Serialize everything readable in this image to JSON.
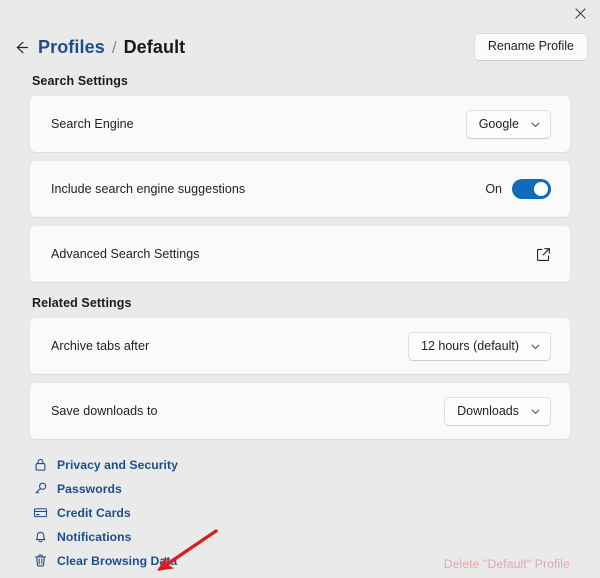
{
  "window": {
    "close_label": "Close",
    "close_icon": "close-icon"
  },
  "header": {
    "back_icon": "arrow-left-icon",
    "breadcrumb_parent": "Profiles",
    "breadcrumb_separator": "/",
    "breadcrumb_current": "Default",
    "rename_button": "Rename Profile"
  },
  "sections": {
    "search": {
      "title": "Search Settings",
      "rows": {
        "search_engine": {
          "label": "Search Engine",
          "value": "Google",
          "chevron_icon": "chevron-down-icon"
        },
        "suggestions": {
          "label": "Include search engine suggestions",
          "state": "On",
          "toggle_icon": "toggle-switch-on"
        },
        "advanced": {
          "label": "Advanced Search Settings",
          "icon": "external-link-icon"
        }
      }
    },
    "related": {
      "title": "Related Settings",
      "rows": {
        "archive_tabs": {
          "label": "Archive tabs after",
          "value": "12 hours (default)",
          "chevron_icon": "chevron-down-icon"
        },
        "save_downloads": {
          "label": "Save downloads to",
          "value": "Downloads",
          "chevron_icon": "chevron-down-icon"
        }
      }
    }
  },
  "links": [
    {
      "label": "Privacy and Security",
      "icon": "lock-icon"
    },
    {
      "label": "Passwords",
      "icon": "key-icon"
    },
    {
      "label": "Credit Cards",
      "icon": "credit-card-icon"
    },
    {
      "label": "Notifications",
      "icon": "bell-icon"
    },
    {
      "label": "Clear Browsing Data",
      "icon": "trash-icon"
    }
  ],
  "delete_profile": {
    "label": "Delete \"Default\" Profile"
  },
  "annotation": {
    "arrow_icon": "red-arrow-pointing-to-clear-browsing-data",
    "color": "#d81f1f"
  },
  "colors": {
    "page_background": "#eaeaea",
    "card_background": "#fafafa",
    "accent_blue": "#0f6cbd",
    "link_blue": "#1f4d8c",
    "delete_red_disabled": "#e0a8ae"
  }
}
